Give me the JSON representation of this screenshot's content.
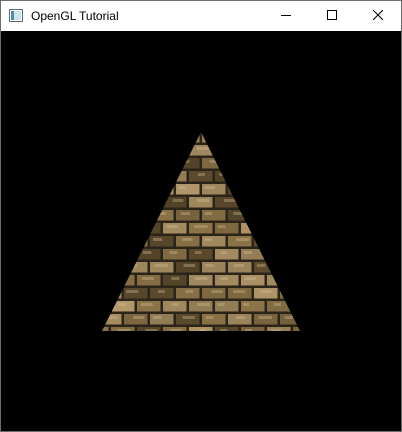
{
  "window": {
    "title": "OpenGL Tutorial",
    "icon": "app-window-icon",
    "controls": {
      "minimize_icon": "minimize-icon",
      "maximize_icon": "maximize-icon",
      "close_icon": "close-icon"
    }
  },
  "scene": {
    "background_color": "#000000",
    "shape": "triangle",
    "texture": "brick-wall",
    "texture_colors": {
      "mortar": "#2b2418",
      "brick_light": "#b59a6b",
      "brick_mid": "#8c7448",
      "brick_dark": "#5e4c2e"
    }
  }
}
